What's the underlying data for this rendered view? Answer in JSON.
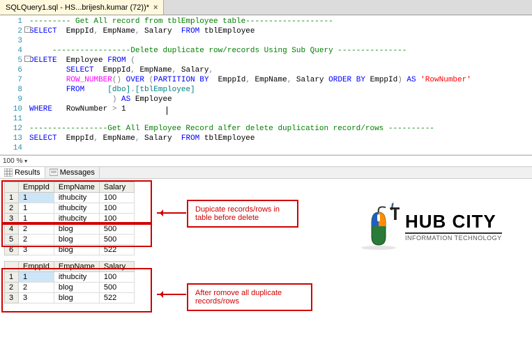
{
  "tab": {
    "title": "SQLQuery1.sql - HS...brijesh.kumar (72))*",
    "close": "×"
  },
  "code": {
    "l1a": "--------- ",
    "l1b": "Get All record from tblEmployee table",
    "l1c": "-------------------",
    "l2a": "SELECT",
    "l2b": "  EmppId",
    "l2c": " EmpName",
    "l2d": " Salary  ",
    "l2e": "FROM",
    "l2f": " tblEmployee",
    "l4a": "-----------------",
    "l4b": "Delete duplicate row/records Using Sub Query ",
    "l4c": "---------------",
    "l5a": "DELETE",
    "l5b": "  Employee ",
    "l5c": "FROM ",
    "l6a": "SELECT",
    "l6b": "  EmppId",
    "l6c": " EmpName",
    "l6d": " Salary",
    "l7a": "ROW_NUMBER",
    "l7b": " OVER ",
    "l7c": "PARTITION",
    "l7d": " BY",
    "l7e": "  EmppId",
    "l7f": " EmpName",
    "l7g": " Salary ",
    "l7h": "ORDER",
    "l7i": " BY",
    "l7j": " EmppId",
    "l7k": " AS",
    "l7l": " 'RowNumber'",
    "l8a": "FROM",
    "l8b": "     [dbo]",
    "l8c": "[tblEmployee]",
    "l9a": " AS",
    "l9b": " Employee",
    "l10a": "WHERE",
    "l10b": "   RowNumber ",
    "l10c": ">",
    "l10d": " 1",
    "l12a": "-----------------",
    "l12b": "Get All Employee Record alfer delete duplication record/rows ",
    "l12c": "----------",
    "l13a": "SELECT",
    "l13b": "  EmppId",
    "l13c": " EmpName",
    "l13d": " Salary  ",
    "l13e": "FROM",
    "l13f": " tblEmployee"
  },
  "zoom": "100 %",
  "tabs": {
    "results": "Results",
    "messages": "Messages"
  },
  "grid": {
    "headers": {
      "c1": "EmppId",
      "c2": "EmpName",
      "c3": "Salary"
    },
    "before": [
      {
        "n": "1",
        "id": "1",
        "name": "ithubcity",
        "sal": "100"
      },
      {
        "n": "2",
        "id": "1",
        "name": "ithubcity",
        "sal": "100"
      },
      {
        "n": "3",
        "id": "1",
        "name": "ithubcity",
        "sal": "100"
      },
      {
        "n": "4",
        "id": "2",
        "name": "blog",
        "sal": "500"
      },
      {
        "n": "5",
        "id": "2",
        "name": "blog",
        "sal": "500"
      },
      {
        "n": "6",
        "id": "3",
        "name": "blog",
        "sal": "522"
      }
    ],
    "after": [
      {
        "n": "1",
        "id": "1",
        "name": "ithubcity",
        "sal": "100"
      },
      {
        "n": "2",
        "id": "2",
        "name": "blog",
        "sal": "500"
      },
      {
        "n": "3",
        "id": "3",
        "name": "blog",
        "sal": "522"
      }
    ]
  },
  "callouts": {
    "before": "Dupicate records/rows in table before delete",
    "after": "After romove all duplicate records/rows"
  },
  "logo": {
    "hub": "HUB CITY",
    "sub": "INFORMATION TECHNOLOGY"
  }
}
